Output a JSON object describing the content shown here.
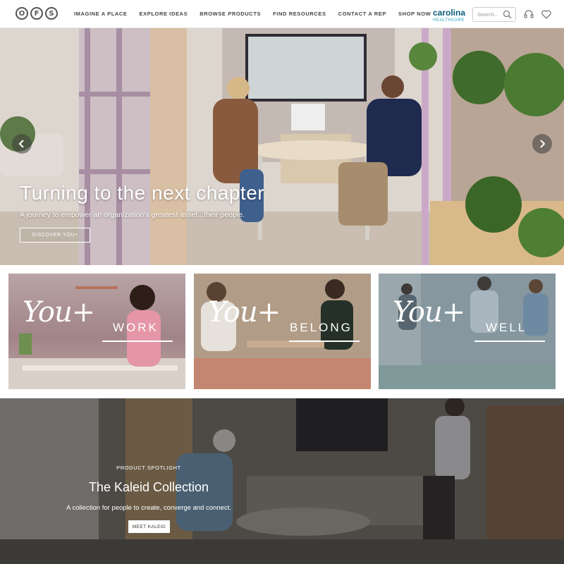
{
  "header": {
    "logo_letters": [
      "O",
      "F",
      "S"
    ],
    "nav": [
      "IMAGINE A PLACE",
      "EXPLORE IDEAS",
      "BROWSE PRODUCTS",
      "FIND RESOURCES",
      "CONTACT A REP",
      "SHOP NOW"
    ],
    "brand_name": "carolina",
    "brand_sub": "HEALTHCARE",
    "search_placeholder": "Search...",
    "icons": [
      "search-icon",
      "headset-icon",
      "heart-icon"
    ]
  },
  "hero": {
    "title": "Turning to the next chapter",
    "subtitle": "A journey to empower an organization's greatest asset...their people.",
    "cta": "DISCOVER YOU+",
    "colors": {
      "accent": "#ffffff"
    }
  },
  "tiles": [
    {
      "script": "You+",
      "word": "WORK"
    },
    {
      "script": "You+",
      "word": "BELONG"
    },
    {
      "script": "You+",
      "word": "WELL"
    }
  ],
  "spotlight": {
    "eyebrow": "PRODUCT SPOTLIGHT",
    "title": "The Kaleid Collection",
    "description": "A collection for people to create, converge and connect.",
    "button": "MEET KALEID"
  }
}
